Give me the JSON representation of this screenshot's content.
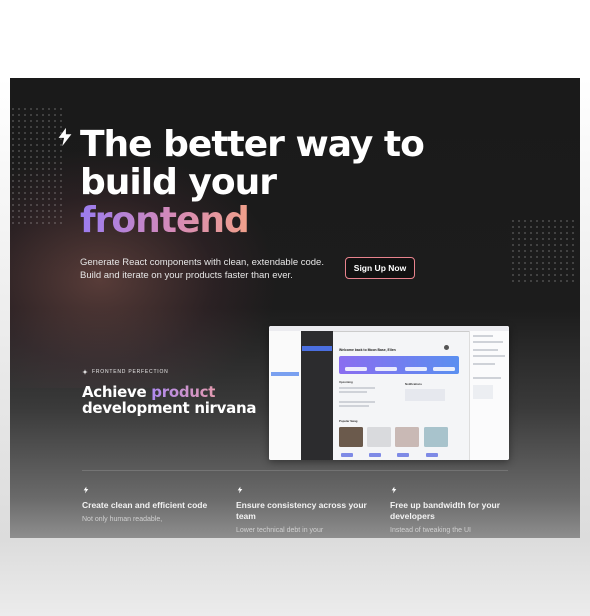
{
  "hero": {
    "title_line1": "The better way to",
    "title_line2": "build your",
    "title_line3": "frontend",
    "subtitle_line1": "Generate React components with clean, extendable code.",
    "subtitle_line2": "Build and iterate on your products faster than ever.",
    "cta_label": "Sign Up Now"
  },
  "section": {
    "eyebrow": "FRONTEND PERFECTION",
    "heading_prefix": "Achieve ",
    "heading_highlight": "product",
    "heading_line2": "development nirvana"
  },
  "mock_app": {
    "welcome": "Welcome back to Moon Base, Ellen",
    "upcoming": "Upcoming",
    "notifications": "Notifications",
    "popular": "Popular Swag"
  },
  "features": [
    {
      "title": "Create clean and efficient code",
      "text": "Not only human readable,"
    },
    {
      "title": "Ensure consistency across your team",
      "text": "Lower technical debt in your"
    },
    {
      "title": "Free up bandwidth for your developers",
      "text": "Instead of tweaking the UI"
    }
  ],
  "icons": {
    "bolt": "lightning-bolt-icon"
  },
  "colors": {
    "cta_border": "#e8838d",
    "gradient_start": "#9a7cf0",
    "gradient_end": "#f0a08a",
    "background": "#1a1a1a"
  }
}
